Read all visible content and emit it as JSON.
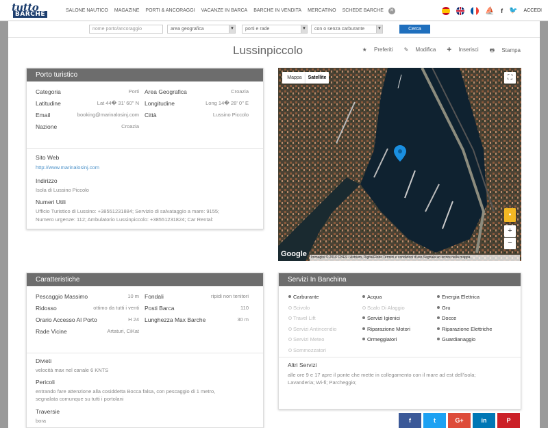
{
  "header": {
    "logo_top": "tutto",
    "logo_bottom": "BARCHE",
    "nav": [
      "SALONE NAUTICO",
      "MAGAZINE",
      "PORTI & ANCORAGGI",
      "VACANZE IN BARCA",
      "BARCHE IN VENDITA",
      "MERCATINO",
      "SCHEDE BARCHE"
    ],
    "login": "ACCEDI",
    "icons": [
      "close-icon",
      "flag-es-icon",
      "flag-gb-icon",
      "flag-fr-icon",
      "boat-icon",
      "facebook-icon",
      "twitter-icon"
    ]
  },
  "search": {
    "name_placeholder": "nome porto/ancoraggio",
    "area": "area geografica",
    "type": "porti e rade",
    "fuel": "con o senza carburante",
    "button": "Cerca"
  },
  "page": {
    "title": "Lussinpiccolo",
    "actions": [
      "Preferiti",
      "Modifica",
      "Inserisci",
      "Stampa"
    ]
  },
  "porto": {
    "header": "Porto turistico",
    "categoria_k": "Categoria",
    "categoria_v": "Porti",
    "lat_k": "Latitudine",
    "lat_v": "Lat 44� 31' 60'' N",
    "email_k": "Email",
    "email_v": "booking@marinalosinj.com",
    "nazione_k": "Nazione",
    "nazione_v": "Croazia",
    "area_k": "Area Geografica",
    "area_v": "Croazia",
    "lon_k": "Longitudine",
    "lon_v": "Long 14� 28' 0'' E",
    "citta_k": "Città",
    "citta_v": "Lussino Piccolo",
    "sito_k": "Sito Web",
    "sito_v": "http://www.marinalosinj.com",
    "indirizzo_k": "Indirizzo",
    "indirizzo_v": "Isola di Lussino Piccolo",
    "numeri_k": "Numeri Utili",
    "numeri_1": "Ufficio Turistico di Lussino: +38551231884; Servizio di salvataggio a mare: 9155;",
    "numeri_2": "Numero urgenze: 112; Ambulatorio Lussinpiccolo: +38551231824; Car Rental:"
  },
  "map": {
    "mappa": "Mappa",
    "satellite": "Satellite",
    "google": "Google",
    "credits": "Immagini © 2016 CNES / Astrium, DigitalGlobe  Termini e condizioni d'uso  Segnala un errore nella mappa",
    "zoom_in": "+",
    "zoom_out": "−"
  },
  "caratteristiche": {
    "header": "Caratteristiche",
    "pescaggio_k": "Pescaggio Massimo",
    "pescaggio_v": "10 m",
    "ridosso_k": "Ridosso",
    "ridosso_v": "ottimo da tutti i venti",
    "orario_k": "Orario Accesso Al Porto",
    "orario_v": "H 24",
    "rade_k": "Rade Vicine",
    "rade_v": "Artaturi, CiKat",
    "fondali_k": "Fondali",
    "fondali_v": "ripidi non tenitori",
    "posti_k": "Posti Barca",
    "posti_v": "110",
    "lung_k": "Lunghezza Max Barche",
    "lung_v": "30 m",
    "divieti_k": "Divieti",
    "divieti_v": "velocità max nel canale 6 KNTS",
    "pericoli_k": "Pericoli",
    "pericoli_1": "entrando fare attenzione alla cosiddetta Bocca falsa, con pescaggio di 1 metro,",
    "pericoli_2": "segnalata comunque su tutti i portolani",
    "traversie_k": "Traversie",
    "traversie_v": "bora"
  },
  "servizi": {
    "header": "Servizi In Banchina",
    "items": [
      {
        "label": "Carburante",
        "on": true
      },
      {
        "label": "Acqua",
        "on": true
      },
      {
        "label": "Energia Elettrica",
        "on": true
      },
      {
        "label": "Scivolo",
        "on": false
      },
      {
        "label": "Scalo Di Alaggio",
        "on": false
      },
      {
        "label": "Gru",
        "on": true
      },
      {
        "label": "Travel Lift",
        "on": false
      },
      {
        "label": "Servizi Igienici",
        "on": true
      },
      {
        "label": "Docce",
        "on": true
      },
      {
        "label": "Servizi Antincendio",
        "on": false
      },
      {
        "label": "Riparazione Motori",
        "on": true
      },
      {
        "label": "Riparazione Elettriche",
        "on": true
      },
      {
        "label": "Servizi Meteo",
        "on": false
      },
      {
        "label": "Ormeggiatori",
        "on": true
      },
      {
        "label": "Guardianaggio",
        "on": true
      },
      {
        "label": "Sommozzatori",
        "on": false
      }
    ],
    "altri_k": "Altri Servizi",
    "altri_1": "alle ore 9 e 17 apre il ponte che mette in collegamento con il mare ad est dell'isola;",
    "altri_2": "Lavanderia; Wi-fi; Parcheggio;"
  },
  "social": [
    {
      "label": "f",
      "color": "#3b5998"
    },
    {
      "label": "t",
      "color": "#1da1f2"
    },
    {
      "label": "G+",
      "color": "#dd4b39"
    },
    {
      "label": "in",
      "color": "#0077b5"
    },
    {
      "label": "P",
      "color": "#cb2027"
    }
  ]
}
